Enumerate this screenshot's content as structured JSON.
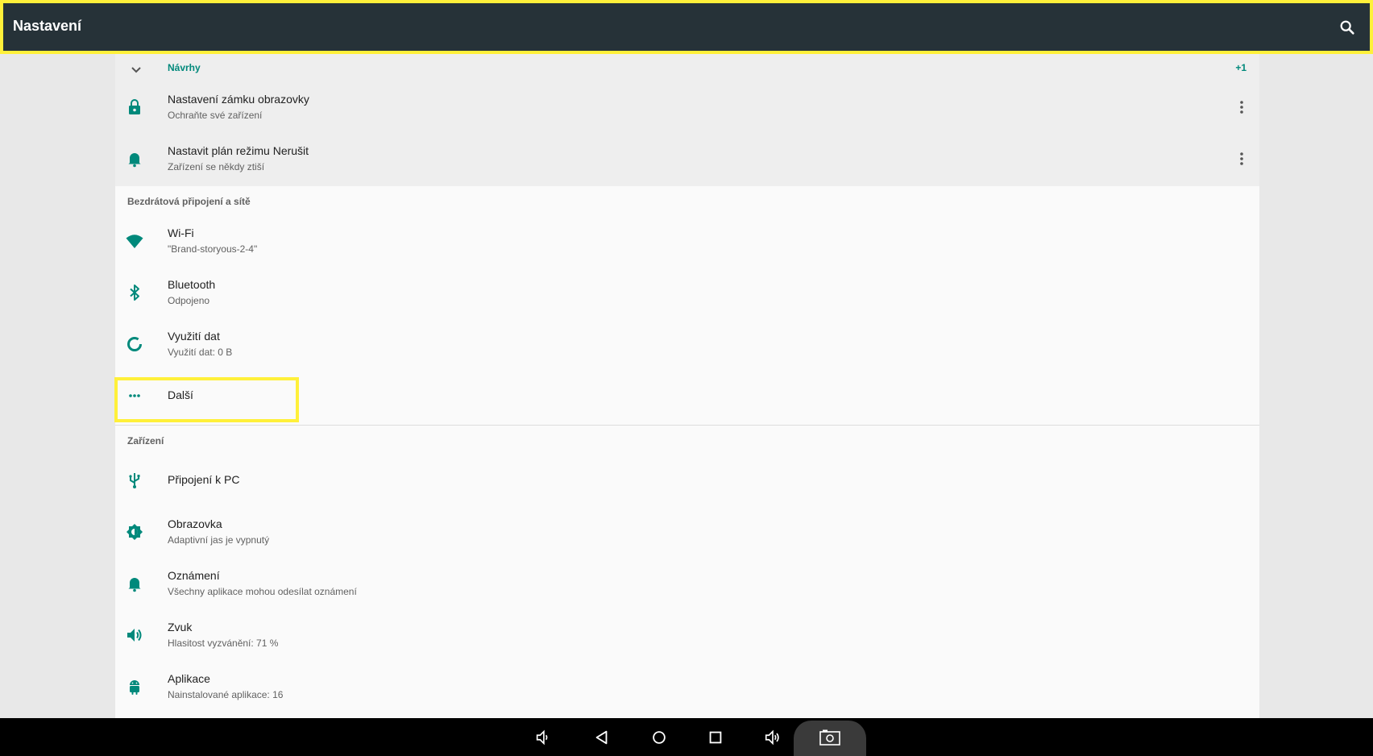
{
  "toolbar": {
    "title": "Nastavení",
    "search_icon": "search-icon"
  },
  "suggestions": {
    "header": "Návrhy",
    "count": "+1",
    "items": [
      {
        "title": "Nastavení zámku obrazovky",
        "subtitle": "Ochraňte své zařízení",
        "icon": "lock-icon"
      },
      {
        "title": "Nastavit plán režimu Nerušit",
        "subtitle": "Zařízení se někdy ztiší",
        "icon": "bell-icon"
      }
    ]
  },
  "categories": [
    {
      "title": "Bezdrátová připojení a sítě",
      "items": [
        {
          "title": "Wi‑Fi",
          "subtitle": "\"Brand-storyous-2-4\"",
          "icon": "wifi-icon"
        },
        {
          "title": "Bluetooth",
          "subtitle": "Odpojeno",
          "icon": "bluetooth-icon"
        },
        {
          "title": "Využití dat",
          "subtitle": "Využití dat: 0 B",
          "icon": "data-usage-icon"
        },
        {
          "title": "Další",
          "icon": "more-horiz-icon"
        }
      ]
    },
    {
      "title": "Zařízení",
      "items": [
        {
          "title": "Připojení k PC",
          "icon": "usb-icon"
        },
        {
          "title": "Obrazovka",
          "subtitle": "Adaptivní jas je vypnutý",
          "icon": "brightness-icon"
        },
        {
          "title": "Oznámení",
          "subtitle": "Všechny aplikace mohou odesílat oznámení",
          "icon": "bell-icon"
        },
        {
          "title": "Zvuk",
          "subtitle": "Hlasitost vyzvánění: 71 %",
          "icon": "volume-icon"
        },
        {
          "title": "Aplikace",
          "subtitle": "Nainstalované aplikace: 16",
          "icon": "android-icon"
        }
      ]
    }
  ],
  "colors": {
    "accent": "#00897b",
    "toolbar": "#263238",
    "highlight": "#fff03a",
    "suggestion_bg": "#eeeeee",
    "background": "#fafafa"
  }
}
